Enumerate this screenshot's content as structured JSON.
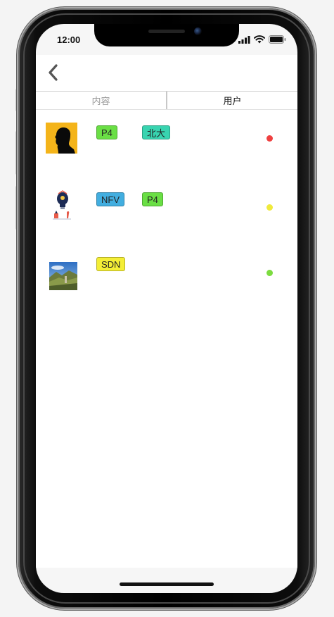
{
  "status_bar": {
    "time": "12:00"
  },
  "header": {
    "back_icon": "chevron-left-icon"
  },
  "tabs": [
    {
      "label": "内容",
      "active": false
    },
    {
      "label": "用户",
      "active": true
    }
  ],
  "users": [
    {
      "avatar": "silhouette-portrait",
      "tags": [
        {
          "label": "P4",
          "color": "#6adf45"
        },
        {
          "label": "北大",
          "color": "#38d4b0"
        }
      ],
      "status_color": "#ef4040"
    },
    {
      "avatar": "lightbulb-illustration",
      "tags": [
        {
          "label": "NFV",
          "color": "#42aee0"
        },
        {
          "label": "P4",
          "color": "#6adf45"
        }
      ],
      "status_color": "#f0ea3c"
    },
    {
      "avatar": "landscape-photo",
      "tags": [
        {
          "label": "SDN",
          "color": "#f4ee36"
        }
      ],
      "status_color": "#7cdc40"
    }
  ]
}
